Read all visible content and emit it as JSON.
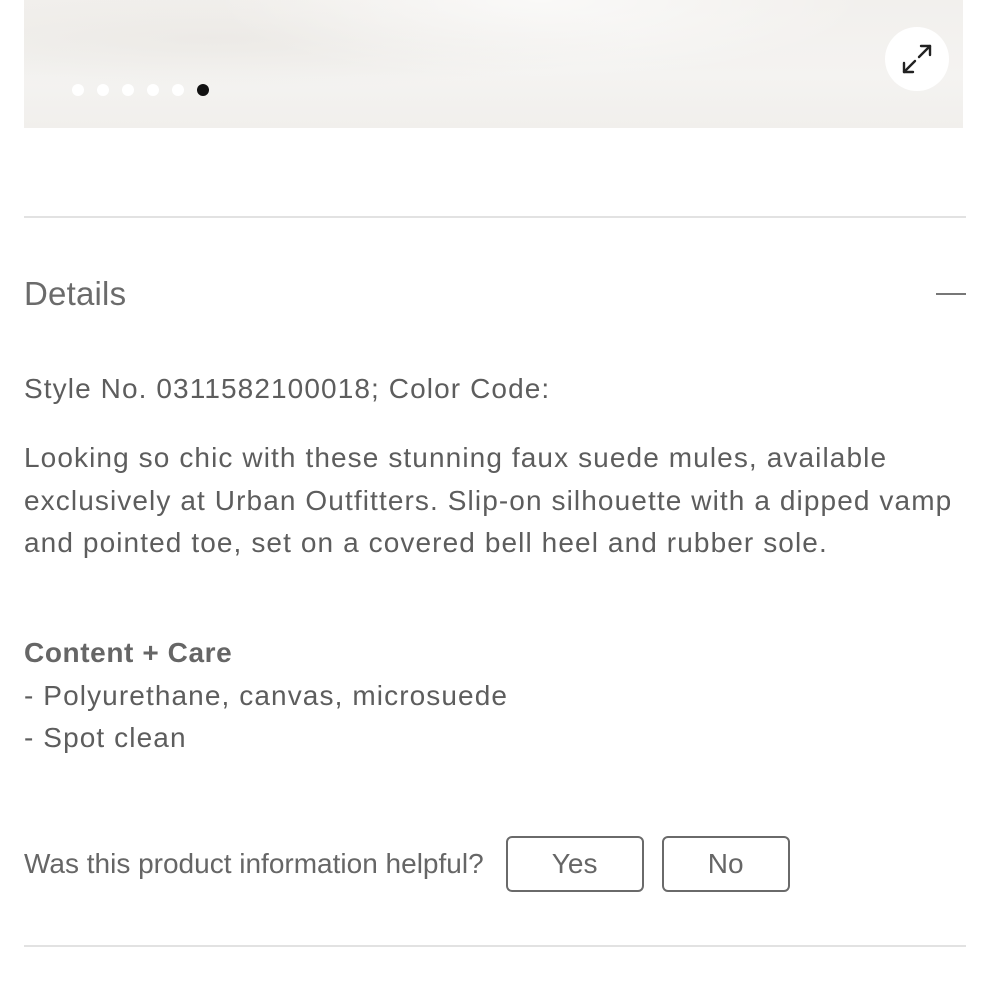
{
  "gallery": {
    "slide_count": 6,
    "active_slide": 6,
    "expand_icon": "expand-arrows-icon"
  },
  "details": {
    "title": "Details",
    "toggle_icon": "minus-icon",
    "style_line": "Style No. 0311582100018; Color Code:",
    "description": "Looking so chic with these stunning faux suede mules, available exclusively at Urban Outfitters. Slip-on silhouette with a dipped vamp and pointed toe, set on a covered bell heel and rubber sole.",
    "care_title": "Content + Care",
    "care_items": [
      "- Polyurethane, canvas, microsuede",
      "- Spot clean"
    ]
  },
  "feedback": {
    "question": "Was this product information helpful?",
    "yes_label": "Yes",
    "no_label": "No"
  }
}
